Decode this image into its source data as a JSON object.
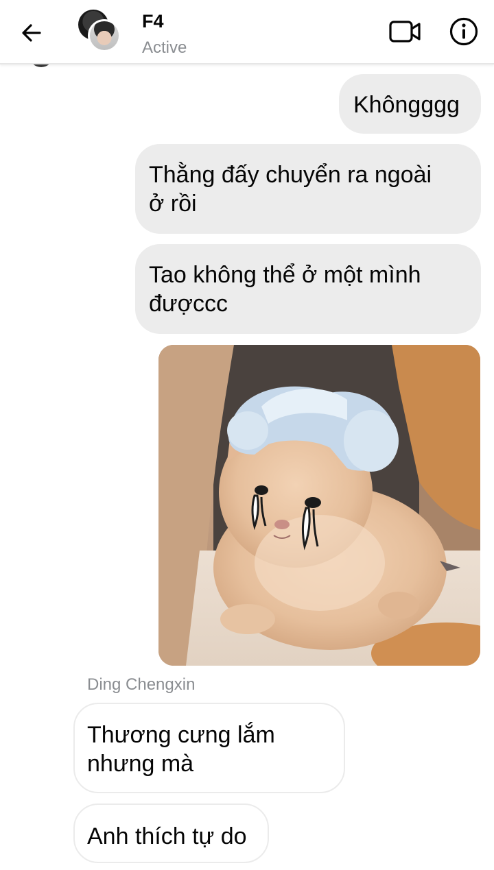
{
  "header": {
    "title": "F4",
    "status": "Active",
    "icons": {
      "back": "back-arrow-icon",
      "video": "video-call-icon",
      "info": "info-icon"
    }
  },
  "messages": [
    {
      "direction": "sent",
      "text": "Khôngggg"
    },
    {
      "direction": "sent",
      "text": "Thằng đấy chuyển ra ngoài ở rồi",
      "lines": [
        "Thằng đấy chuyển ra ngoài",
        "ở rồi"
      ]
    },
    {
      "direction": "sent",
      "text": "Tao không thể ở một mình đượccc",
      "lines": [
        "Tao không thể ở một mình",
        "đượccc"
      ]
    },
    {
      "direction": "sent",
      "type": "sticker",
      "sticker": "crying-kitten-sticker",
      "watermark": "tiny_seal"
    },
    {
      "direction": "received",
      "sender": "Ding Chengxin",
      "text": "Thương cưng lắm nhưng mà",
      "lines": [
        "Thương cưng lắm",
        "nhưng mà"
      ]
    },
    {
      "direction": "received",
      "text": "Anh thích tự do"
    }
  ],
  "colors": {
    "sent_bubble": "#ececec",
    "received_bubble": "#ffffff",
    "secondary_text": "#8a8d91"
  }
}
